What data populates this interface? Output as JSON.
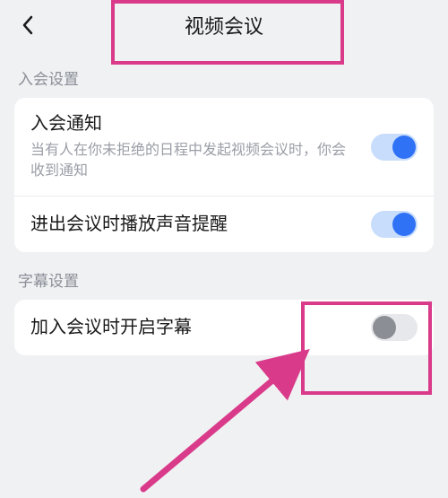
{
  "header": {
    "title": "视频会议"
  },
  "sections": {
    "join": {
      "label": "入会设置",
      "items": {
        "notify": {
          "title": "入会通知",
          "subtitle": "当有人在你未拒绝的日程中发起视频会议时，你会收到通知",
          "on": true
        },
        "sound": {
          "title": "进出会议时播放声音提醒",
          "on": true
        }
      }
    },
    "subtitle": {
      "label": "字幕设置",
      "items": {
        "autoSub": {
          "title": "加入会议时开启字幕",
          "on": false
        }
      }
    }
  },
  "annotation": {
    "color": "#d93b8a"
  }
}
